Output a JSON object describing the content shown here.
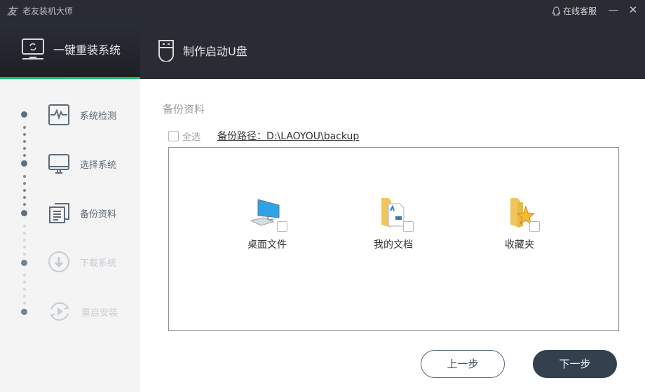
{
  "titlebar": {
    "logo": "友",
    "title": "老友装机大师",
    "service": "在线客服",
    "minimize": "—",
    "close": "✕"
  },
  "tabs": [
    {
      "label": "一键重装系统",
      "active": true
    },
    {
      "label": "制作启动U盘",
      "active": false
    }
  ],
  "steps": [
    {
      "label": "系统检测",
      "icon": "pulse-monitor-icon",
      "done": true
    },
    {
      "label": "选择系统",
      "icon": "monitor-icon",
      "done": true
    },
    {
      "label": "备份资料",
      "icon": "documents-icon",
      "done": true
    },
    {
      "label": "下载系统",
      "icon": "download-icon",
      "done": false
    },
    {
      "label": "重启安装",
      "icon": "restart-icon",
      "done": false
    }
  ],
  "main": {
    "title": "备份资料",
    "select_all": "全选",
    "backup_path": "备份路径：D:\\LAOYOU\\backup",
    "items": [
      {
        "label": "桌面文件",
        "checked": false
      },
      {
        "label": "我的文档",
        "checked": false
      },
      {
        "label": "收藏夹",
        "checked": false
      }
    ],
    "prev": "上一步",
    "next": "下一步"
  },
  "colors": {
    "accent": "#1fbf6b",
    "header": "#292d33",
    "button": "#33414f"
  }
}
